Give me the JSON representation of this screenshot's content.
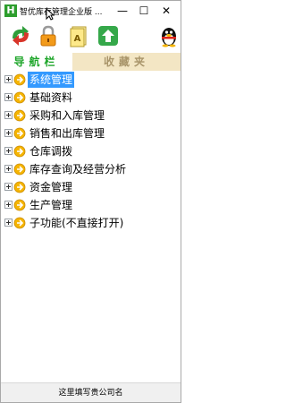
{
  "window": {
    "title": "智优库存管理企业版 ...",
    "app_icon_letter": "H",
    "minimize_glyph": "—",
    "maximize_glyph": "☐",
    "close_glyph": "✕"
  },
  "toolbar": {
    "items": [
      {
        "name": "refresh-icon"
      },
      {
        "name": "lock-icon"
      },
      {
        "name": "note-icon"
      },
      {
        "name": "upload-icon"
      },
      {
        "name": "qq-penguin-icon"
      }
    ]
  },
  "tabs": {
    "nav": "导航栏",
    "favorites": "收藏夹"
  },
  "tree": {
    "nodes": [
      {
        "label": "系统管理",
        "selected": true
      },
      {
        "label": "基础资料"
      },
      {
        "label": "采购和入库管理"
      },
      {
        "label": "销售和出库管理"
      },
      {
        "label": "仓库调拨"
      },
      {
        "label": "库存查询及经营分析"
      },
      {
        "label": "资金管理"
      },
      {
        "label": "生产管理"
      },
      {
        "label": "子功能(不直接打开)"
      }
    ]
  },
  "colors": {
    "tab_nav_text": "#1fa62b",
    "tab_fav_bg": "#f3e6c4",
    "selection": "#3399ff",
    "node_icon": "#f5b400"
  },
  "statusbar": {
    "text": "这里填写贵公司名"
  }
}
